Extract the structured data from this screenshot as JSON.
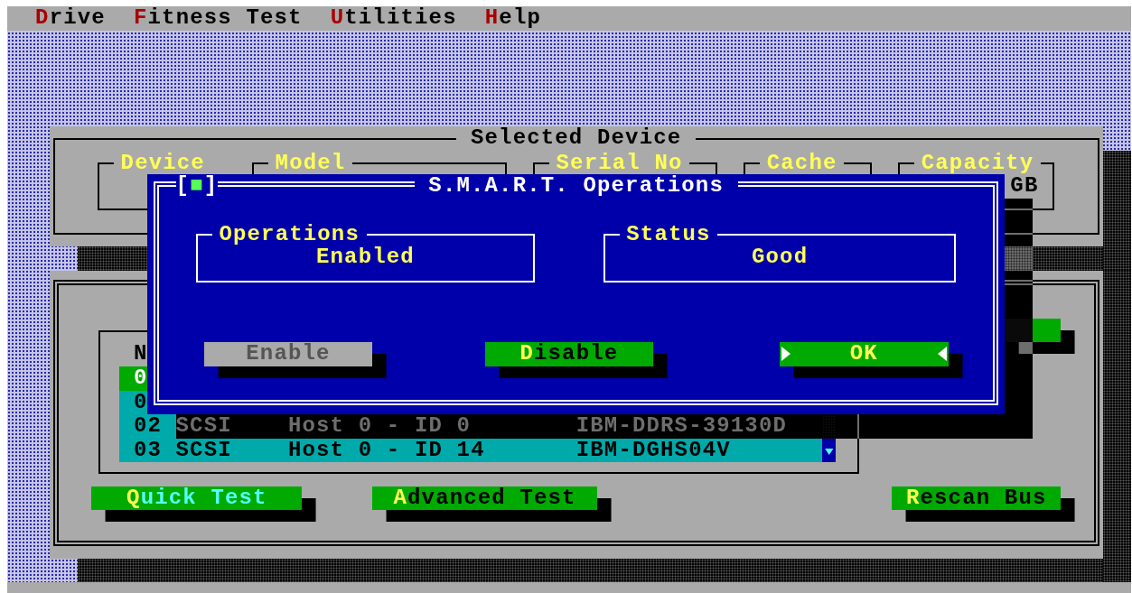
{
  "menu": [
    {
      "hotkey": "D",
      "rest": "rive"
    },
    {
      "hotkey": "F",
      "rest": "itness Test"
    },
    {
      "hotkey": "U",
      "rest": "tilities"
    },
    {
      "hotkey": "H",
      "rest": "elp"
    }
  ],
  "selected_device": {
    "title": "Selected Device",
    "fields": [
      {
        "label": "Device"
      },
      {
        "label": "Model"
      },
      {
        "label": "Serial No"
      },
      {
        "label": "Cache"
      },
      {
        "label": "Capacity",
        "value": "GB"
      }
    ]
  },
  "device_list": {
    "columns": [
      {
        "label": "N"
      }
    ],
    "rows": [
      {
        "no": "0",
        "selected": true
      },
      {
        "no": "0",
        "selected": false
      },
      {
        "no": "02",
        "type": "SCSI",
        "location": "Host 0 - ID 0",
        "model": "IBM-DDRS-39130D",
        "selected": false
      },
      {
        "no": "03",
        "type": "SCSI",
        "location": "Host 0 - ID 14",
        "model": "IBM-DGHS04V",
        "selected": false
      }
    ]
  },
  "buttons": [
    {
      "hotkey": "Q",
      "rest": "uick Test",
      "focused": true
    },
    {
      "hotkey": "A",
      "rest": "dvanced Test",
      "focused": false
    },
    {
      "hotkey": "R",
      "rest": "escan Bus",
      "focused": false
    }
  ],
  "dialog": {
    "close_box": {
      "open": "[",
      "mark": "■",
      "close": "]"
    },
    "title": "S.M.A.R.T. Operations",
    "boxes": [
      {
        "label": "Operations",
        "value": "Enabled"
      },
      {
        "label": "Status",
        "value": "Good"
      }
    ],
    "buttons": [
      {
        "hotkey": "E",
        "rest": "nable",
        "disabled": true,
        "focused": false
      },
      {
        "hotkey": "D",
        "rest": "isable",
        "disabled": false,
        "focused": false
      },
      {
        "hotkey": "OK",
        "disabled": false,
        "focused": true
      }
    ]
  }
}
